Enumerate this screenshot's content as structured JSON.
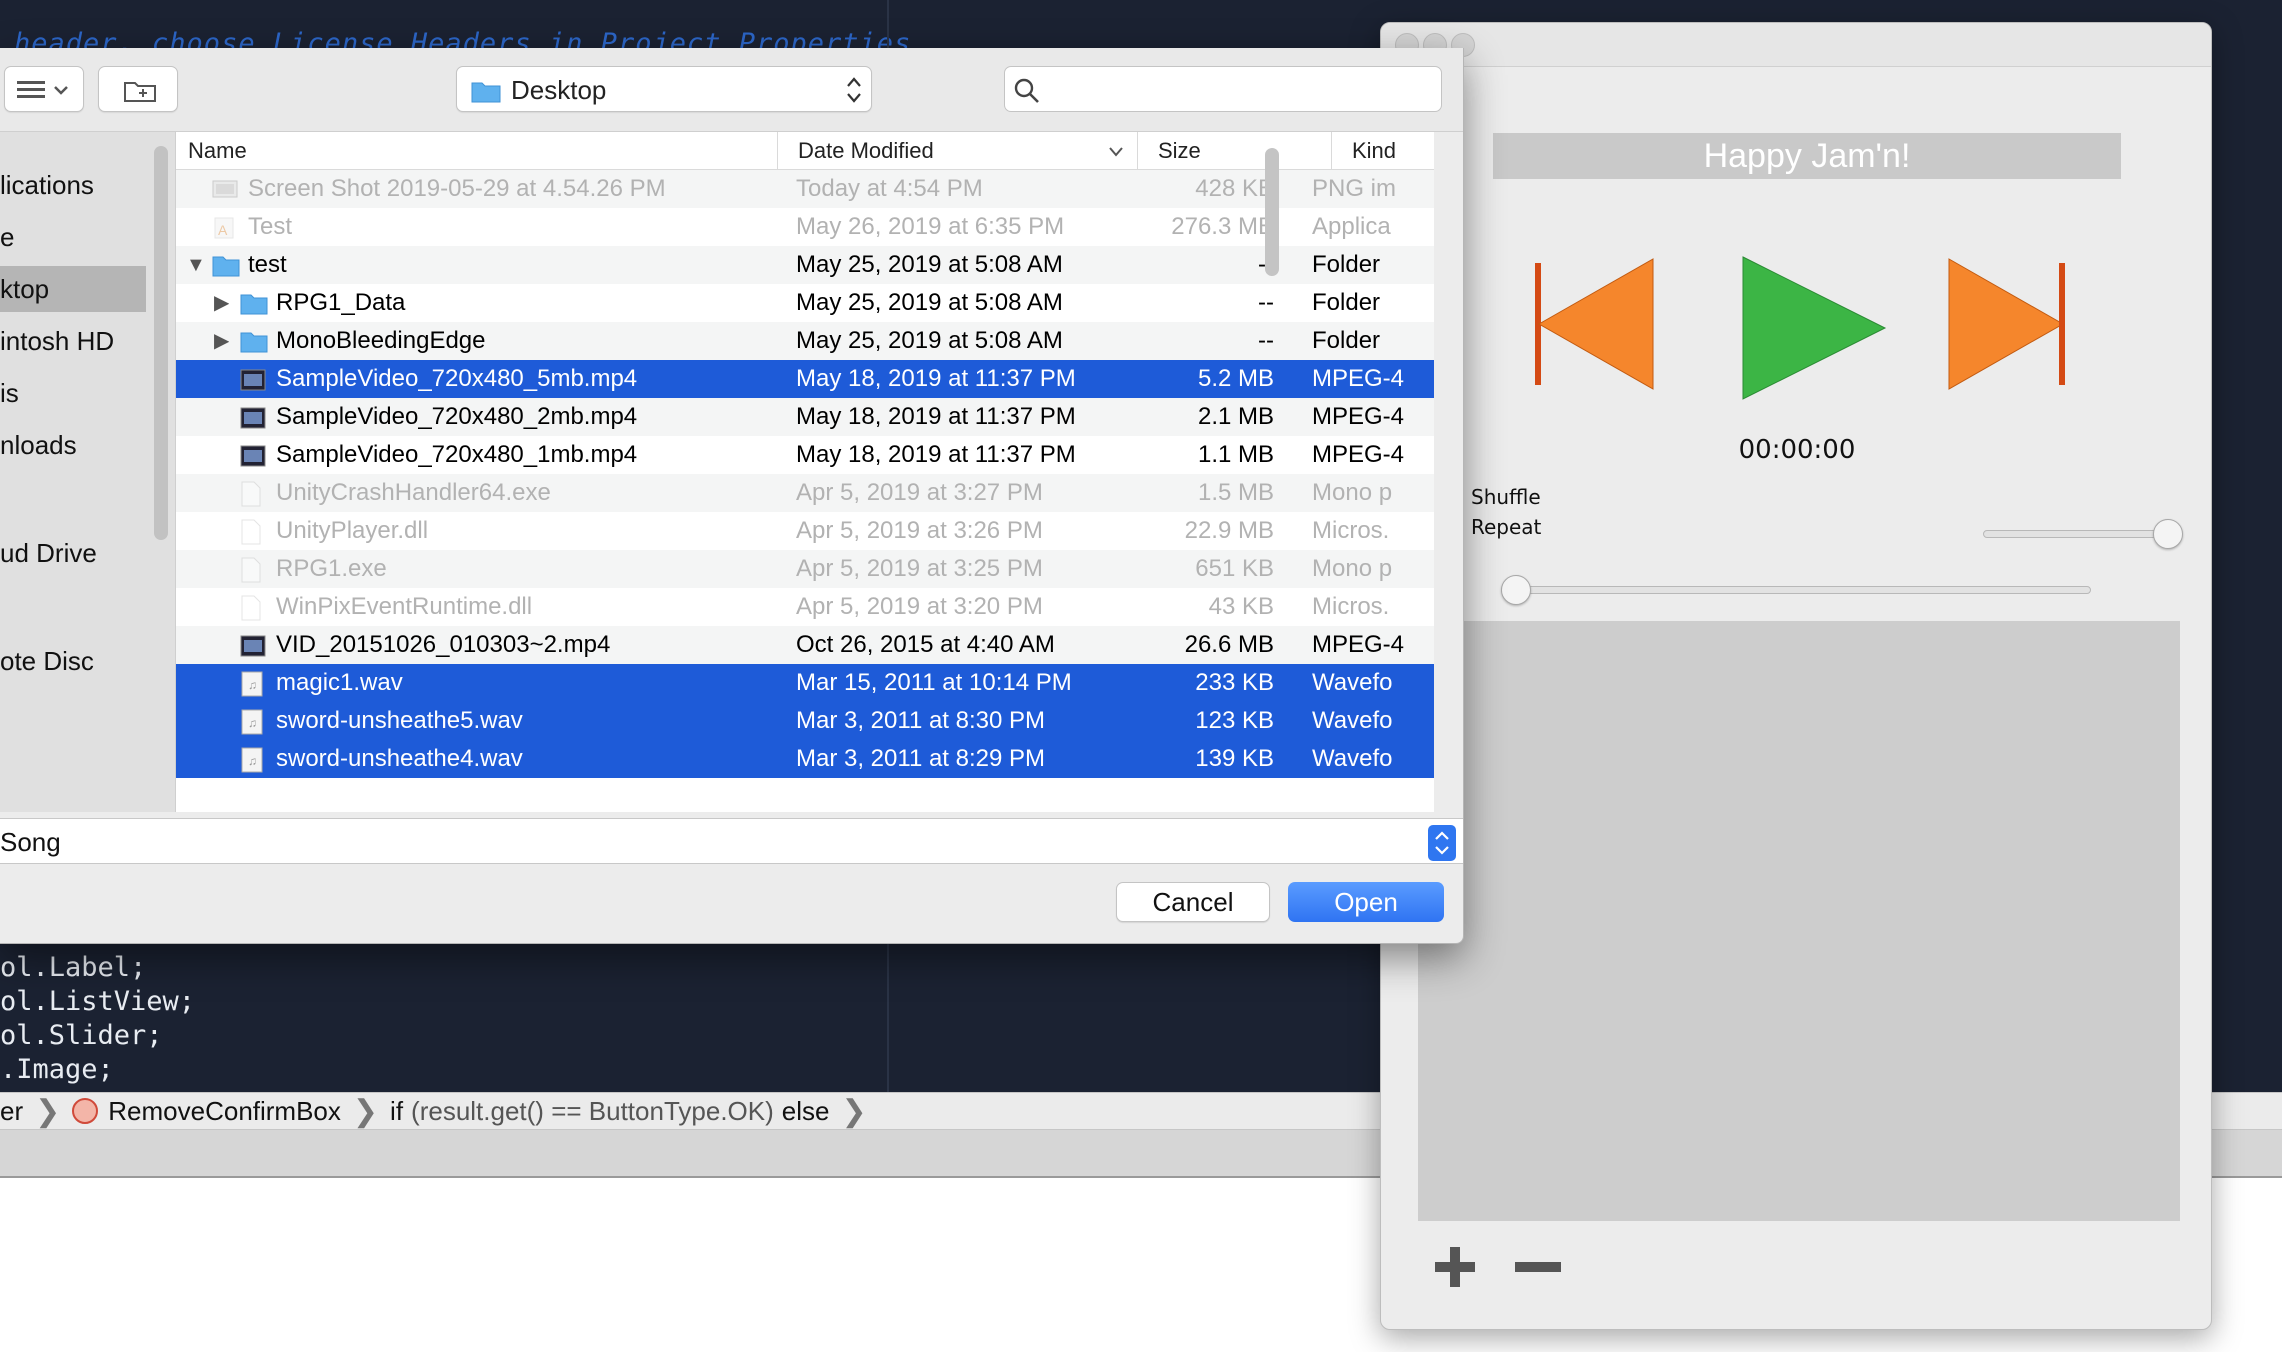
{
  "ide": {
    "header_comment": "header, choose License Headers in Project Properties",
    "code_lines": [
      "ol.Label;",
      "ol.ListView;",
      "ol.Slider;",
      ".Image;"
    ],
    "breadcrumb": {
      "item1": "er",
      "item2": "RemoveConfirmBox",
      "item3_prefix": "if",
      "item3_cond": "(result.get() == ButtonType.OK)",
      "item3_suffix": "else"
    }
  },
  "player": {
    "title": "Happy Jam'n!",
    "time": "00:00:00",
    "shuffle_label": "Shuffle",
    "repeat_label": "Repeat",
    "volume_level": 1.0,
    "seek_level": 0.0,
    "colors": {
      "nav": "#f5862c",
      "play": "#3cb545"
    }
  },
  "dialog": {
    "location": "Desktop",
    "search_placeholder": "",
    "sidebar": {
      "items": [
        "lications",
        "e",
        "ktop",
        "intosh HD",
        "is",
        "nloads",
        "ud Drive",
        "ote Disc"
      ],
      "selected": "ktop"
    },
    "columns": {
      "name": "Name",
      "date": "Date Modified",
      "size": "Size",
      "kind": "Kind"
    },
    "rows": [
      {
        "name": "Screen Shot 2019-05-29 at 4.54.26 PM",
        "date": "Today at 4:54 PM",
        "size": "428 KB",
        "kind": "PNG im",
        "icon": "image-file-icon"
      },
      {
        "name": "Test",
        "date": "May 26, 2019 at 6:35 PM",
        "size": "276.3 MB",
        "kind": "Applica",
        "icon": "app-icon"
      },
      {
        "name": "test",
        "date": "May 25, 2019 at 5:08 AM",
        "size": "--",
        "kind": "Folder",
        "icon": "folder-icon"
      },
      {
        "name": "RPG1_Data",
        "date": "May 25, 2019 at 5:08 AM",
        "size": "--",
        "kind": "Folder",
        "icon": "folder-icon"
      },
      {
        "name": "MonoBleedingEdge",
        "date": "May 25, 2019 at 5:08 AM",
        "size": "--",
        "kind": "Folder",
        "icon": "folder-icon"
      },
      {
        "name": "SampleVideo_720x480_5mb.mp4",
        "date": "May 18, 2019 at 11:37 PM",
        "size": "5.2 MB",
        "kind": "MPEG-4",
        "icon": "video-file-icon"
      },
      {
        "name": "SampleVideo_720x480_2mb.mp4",
        "date": "May 18, 2019 at 11:37 PM",
        "size": "2.1 MB",
        "kind": "MPEG-4",
        "icon": "video-file-icon"
      },
      {
        "name": "SampleVideo_720x480_1mb.mp4",
        "date": "May 18, 2019 at 11:37 PM",
        "size": "1.1 MB",
        "kind": "MPEG-4",
        "icon": "video-file-icon"
      },
      {
        "name": "UnityCrashHandler64.exe",
        "date": "Apr 5, 2019 at 3:27 PM",
        "size": "1.5 MB",
        "kind": "Mono p",
        "icon": "document-icon"
      },
      {
        "name": "UnityPlayer.dll",
        "date": "Apr 5, 2019 at 3:26 PM",
        "size": "22.9 MB",
        "kind": "Micros.",
        "icon": "document-icon"
      },
      {
        "name": "RPG1.exe",
        "date": "Apr 5, 2019 at 3:25 PM",
        "size": "651 KB",
        "kind": "Mono p",
        "icon": "document-icon"
      },
      {
        "name": "WinPixEventRuntime.dll",
        "date": "Apr 5, 2019 at 3:20 PM",
        "size": "43 KB",
        "kind": "Micros.",
        "icon": "document-icon"
      },
      {
        "name": "VID_20151026_010303~2.mp4",
        "date": "Oct 26, 2015 at 4:40 AM",
        "size": "26.6 MB",
        "kind": "MPEG-4",
        "icon": "video-file-icon"
      },
      {
        "name": "magic1.wav",
        "date": "Mar 15, 2011 at 10:14 PM",
        "size": "233 KB",
        "kind": "Wavefo",
        "icon": "audio-file-icon"
      },
      {
        "name": "sword-unsheathe5.wav",
        "date": "Mar 3, 2011 at 8:30 PM",
        "size": "123 KB",
        "kind": "Wavefo",
        "icon": "audio-file-icon"
      },
      {
        "name": "sword-unsheathe4.wav",
        "date": "Mar 3, 2011 at 8:29 PM",
        "size": "139 KB",
        "kind": "Wavefo",
        "icon": "audio-file-icon"
      }
    ],
    "file_type": "Song",
    "cancel_label": "Cancel",
    "open_label": "Open"
  }
}
